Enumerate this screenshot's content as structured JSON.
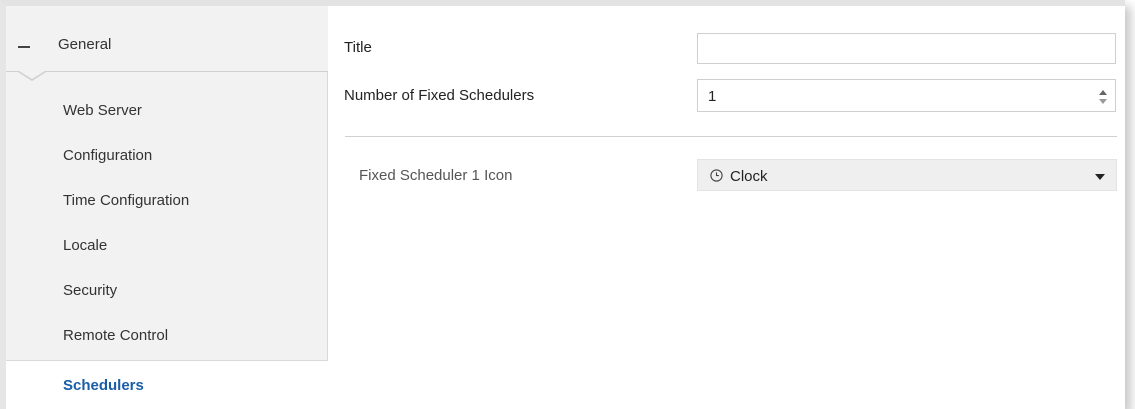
{
  "sidebar": {
    "group": {
      "label": "General"
    },
    "items": [
      {
        "label": "Web Server"
      },
      {
        "label": "Configuration"
      },
      {
        "label": "Time Configuration"
      },
      {
        "label": "Locale"
      },
      {
        "label": "Security"
      },
      {
        "label": "Remote Control"
      },
      {
        "label": "Schedulers"
      }
    ],
    "active_item": "Schedulers"
  },
  "form": {
    "title": {
      "label": "Title",
      "value": ""
    },
    "fixed_schedulers": {
      "label": "Number of Fixed Schedulers",
      "value": "1"
    },
    "scheduler_icon": {
      "label": "Fixed Scheduler 1 Icon",
      "value": "Clock",
      "icon": "clock-icon"
    }
  },
  "colors": {
    "active_text": "#1a5ea8",
    "sidebar_bg": "#f2f2f2",
    "select_bg": "#efefef"
  }
}
